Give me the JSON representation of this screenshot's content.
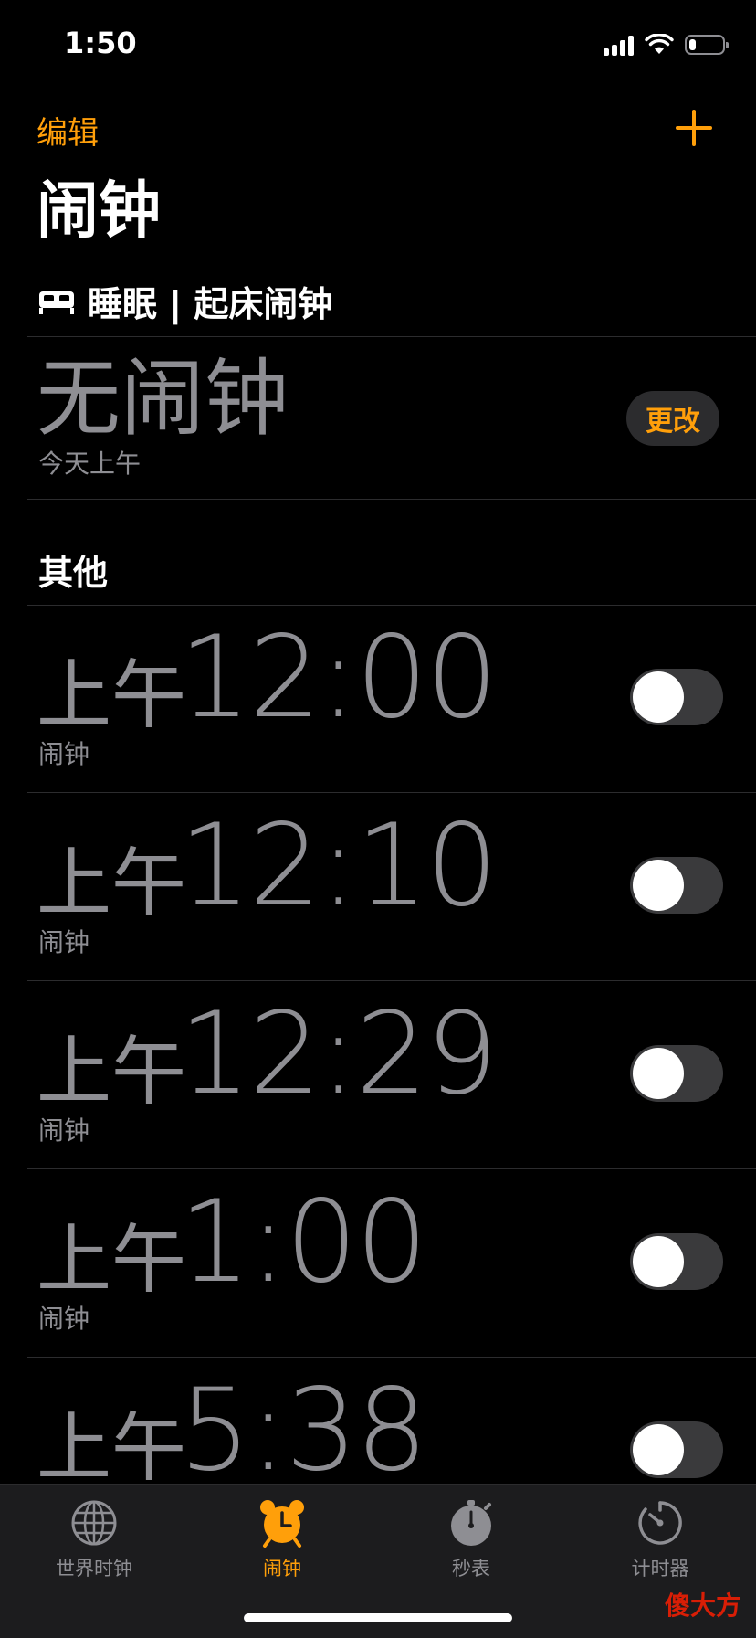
{
  "status_bar": {
    "time": "1:50",
    "battery_level_percent": 20
  },
  "navigation": {
    "edit_label": "编辑",
    "add_icon": "plus-icon"
  },
  "page": {
    "title": "闹钟"
  },
  "sleep_section": {
    "icon": "bed-icon",
    "title": "睡眠 | 起床闹钟",
    "status": "无闹钟",
    "subtitle": "今天上午",
    "change_label": "更改"
  },
  "other_section": {
    "title": "其他"
  },
  "alarms": [
    {
      "ampm": "上午",
      "time": "12:00",
      "label": "闹钟",
      "enabled": false
    },
    {
      "ampm": "上午",
      "time": "12:10",
      "label": "闹钟",
      "enabled": false
    },
    {
      "ampm": "上午",
      "time": "12:29",
      "label": "闹钟",
      "enabled": false
    },
    {
      "ampm": "上午",
      "time": "1:00",
      "label": "闹钟",
      "enabled": false
    },
    {
      "ampm": "上午",
      "time": "5:38",
      "label": "",
      "enabled": false
    }
  ],
  "tabs": [
    {
      "label": "世界时钟",
      "icon": "globe-icon",
      "active": false
    },
    {
      "label": "闹钟",
      "icon": "alarm-clock-icon",
      "active": true
    },
    {
      "label": "秒表",
      "icon": "stopwatch-icon",
      "active": false
    },
    {
      "label": "计时器",
      "icon": "timer-icon",
      "active": false
    }
  ],
  "watermark": "傻大方",
  "colors": {
    "accent": "#ff9f0a",
    "background": "#000000",
    "secondary_text": "#8e8e93",
    "tab_bar": "#1c1c1e"
  }
}
